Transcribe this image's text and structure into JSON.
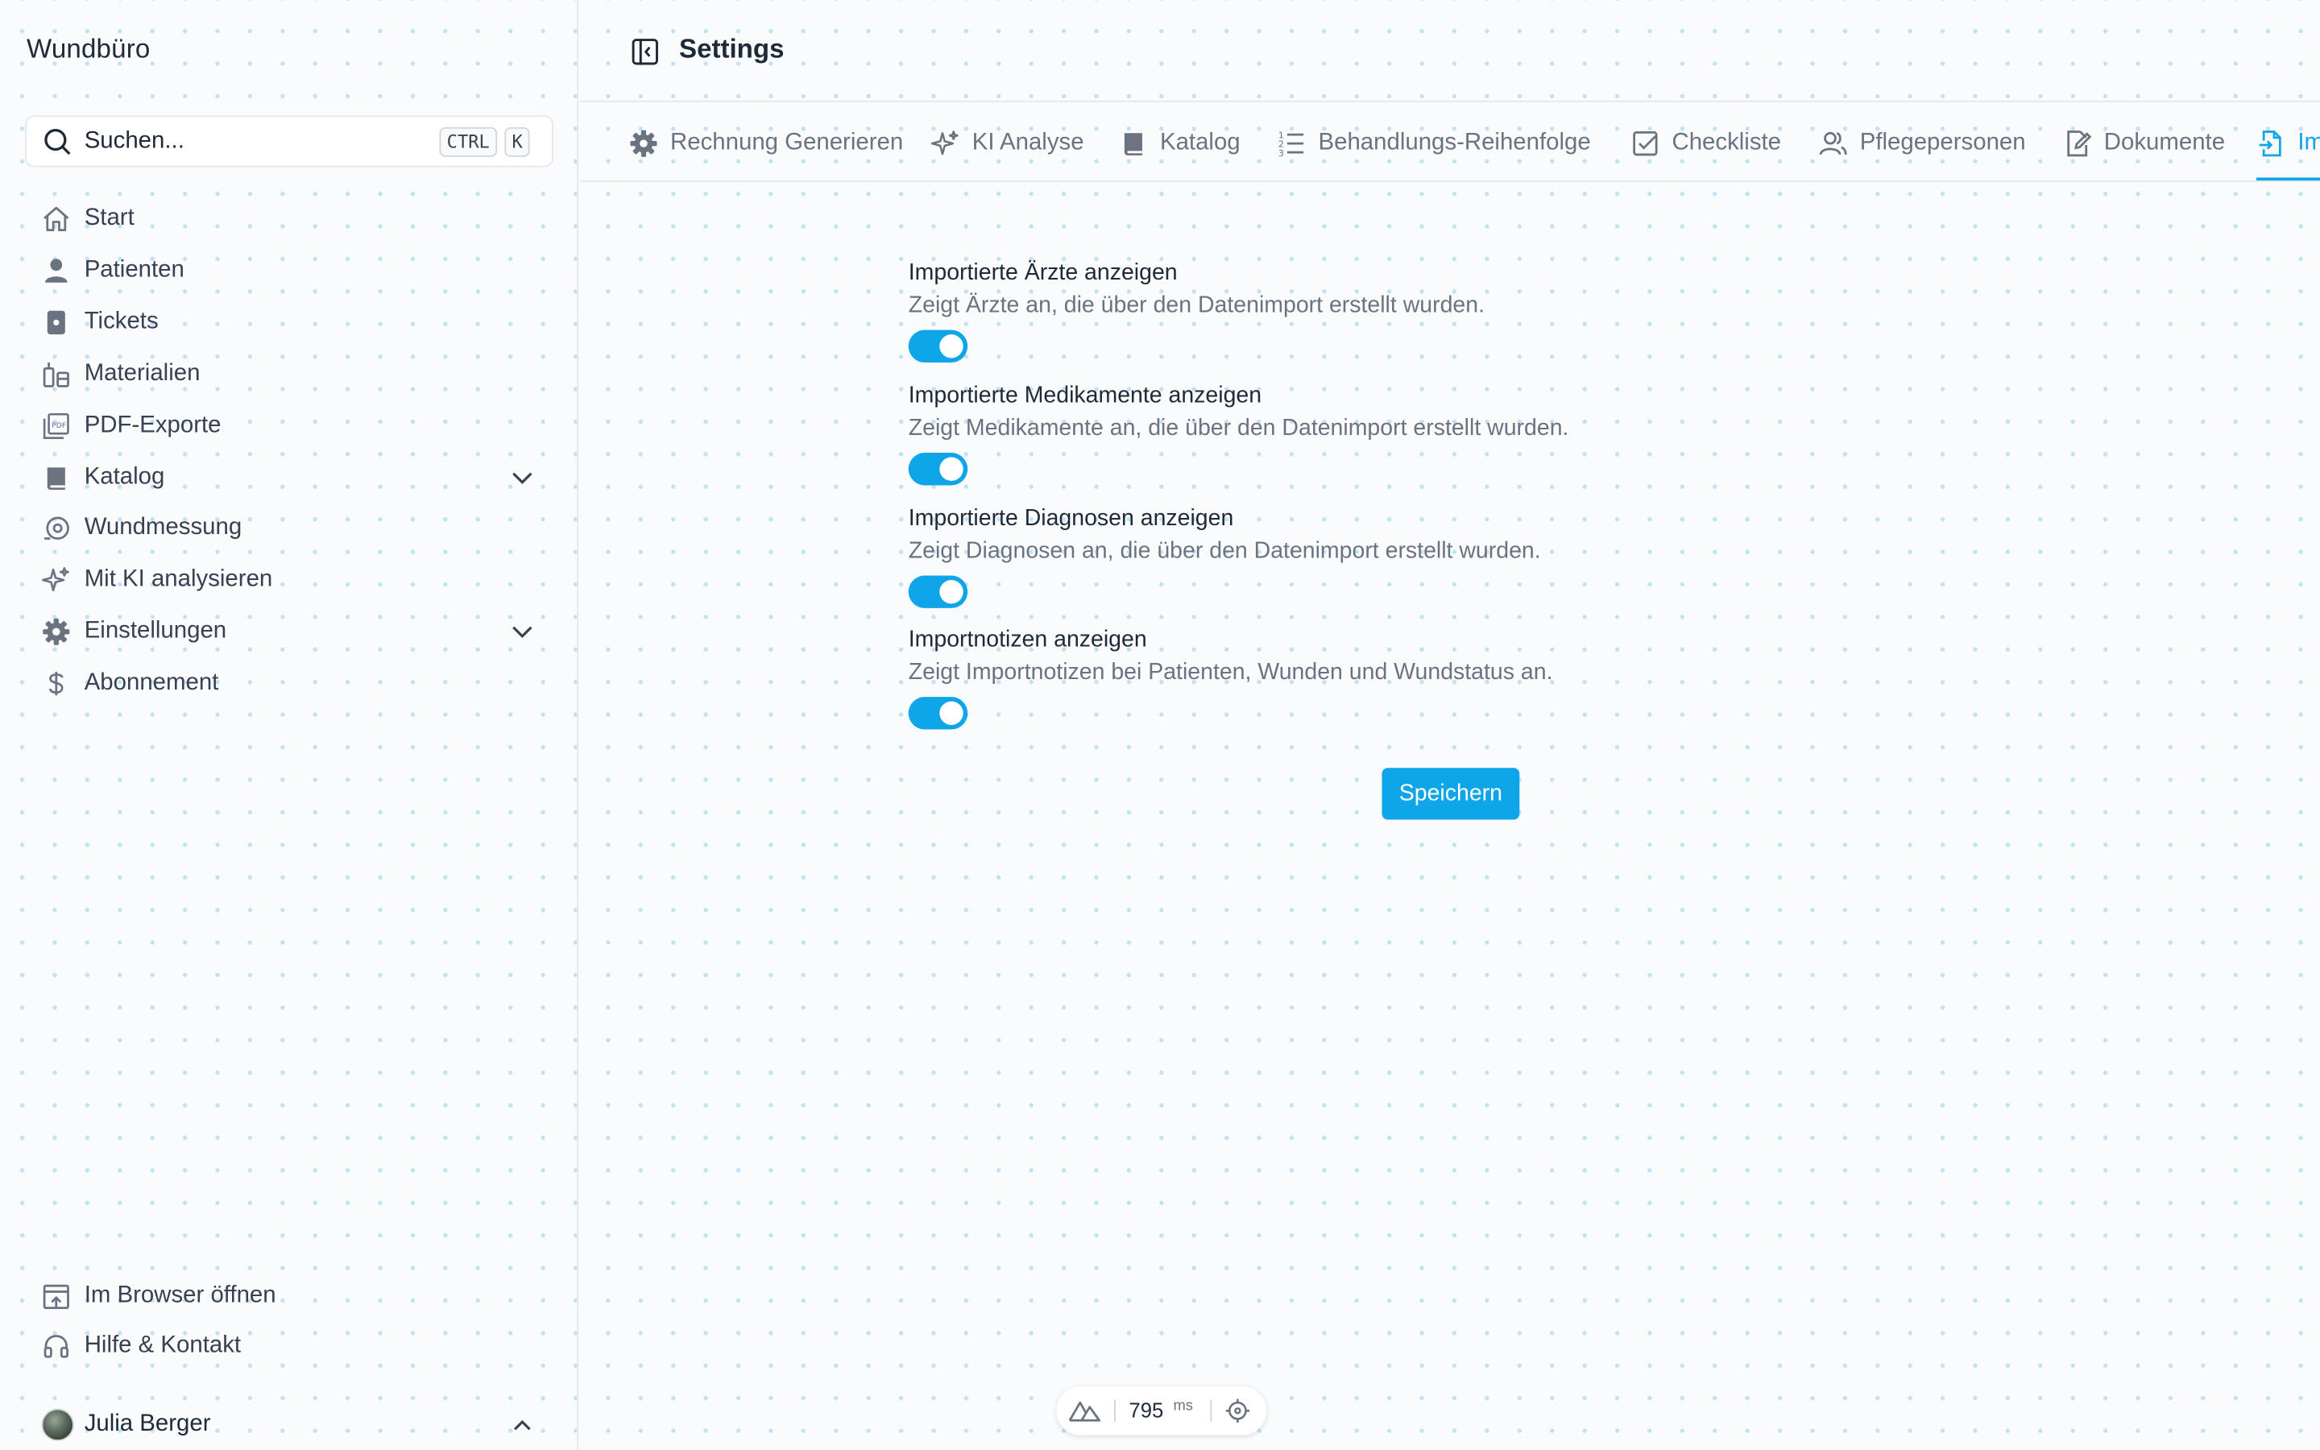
{
  "app": {
    "brand": "Wundbüro"
  },
  "search": {
    "placeholder": "Suchen...",
    "kbd_ctrl": "CTRL",
    "kbd_k": "K"
  },
  "sidebar": {
    "items": [
      {
        "label": "Start",
        "icon": "home-icon"
      },
      {
        "label": "Patienten",
        "icon": "user-icon"
      },
      {
        "label": "Tickets",
        "icon": "ticket-icon"
      },
      {
        "label": "Materialien",
        "icon": "materials-icon"
      },
      {
        "label": "PDF-Exporte",
        "icon": "pdf-icon"
      },
      {
        "label": "Katalog",
        "icon": "book-icon",
        "expandable": true
      },
      {
        "label": "Wundmessung",
        "icon": "measure-icon"
      },
      {
        "label": "Mit KI analysieren",
        "icon": "sparkles-icon"
      },
      {
        "label": "Einstellungen",
        "icon": "gear-icon",
        "expandable": true
      },
      {
        "label": "Abonnement",
        "icon": "dollar-icon"
      }
    ],
    "bottom_items": [
      {
        "label": "Im Browser öffnen",
        "icon": "browser-open-icon"
      },
      {
        "label": "Hilfe & Kontakt",
        "icon": "headset-icon"
      }
    ],
    "user": {
      "name": "Julia Berger"
    }
  },
  "header": {
    "title": "Settings"
  },
  "tabs": [
    {
      "label": "Rechnung Generieren",
      "icon": "gear-icon"
    },
    {
      "label": "KI Analyse",
      "icon": "sparkles-icon"
    },
    {
      "label": "Katalog",
      "icon": "book-icon"
    },
    {
      "label": "Behandlungs-Reihenfolge",
      "icon": "ordered-list-icon"
    },
    {
      "label": "Checkliste",
      "icon": "checkbox-icon"
    },
    {
      "label": "Pflegepersonen",
      "icon": "users-icon"
    },
    {
      "label": "Dokumente",
      "icon": "document-edit-icon"
    },
    {
      "label": "Im",
      "icon": "file-import-icon",
      "active": true
    }
  ],
  "settings": [
    {
      "title": "Importierte Ärzte anzeigen",
      "description": "Zeigt Ärzte an, die über den Datenimport erstellt wurden.",
      "enabled": true
    },
    {
      "title": "Importierte Medikamente anzeigen",
      "description": "Zeigt Medikamente an, die über den Datenimport erstellt wurden.",
      "enabled": true
    },
    {
      "title": "Importierte Diagnosen anzeigen",
      "description": "Zeigt Diagnosen an, die über den Datenimport erstellt wurden.",
      "enabled": true
    },
    {
      "title": "Importnotizen anzeigen",
      "description": "Zeigt Importnotizen bei Patienten, Wunden und Wundstatus an.",
      "enabled": true
    }
  ],
  "save_label": "Speichern",
  "perf": {
    "value": "795",
    "unit": "ms"
  },
  "colors": {
    "accent": "#0ea5e9",
    "text": "#1f2937",
    "muted": "#6b7280",
    "border": "#e5e7eb"
  }
}
